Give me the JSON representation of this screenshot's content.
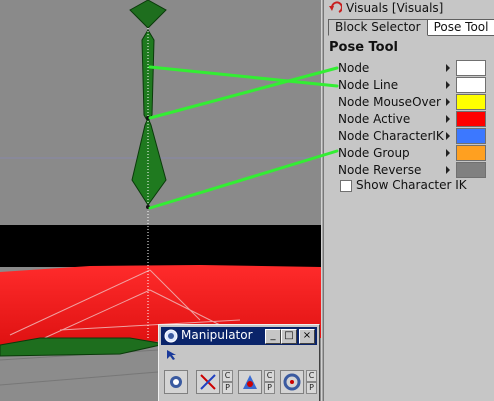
{
  "panel": {
    "title": "Visuals [Visuals]",
    "tabs": [
      {
        "label": "Block Selector"
      },
      {
        "label": "Pose Tool"
      }
    ],
    "section_title": "Pose Tool",
    "properties": [
      {
        "label": "Node",
        "color": "#ffffff"
      },
      {
        "label": "Node Line",
        "color": "#ffffff"
      },
      {
        "label": "Node MouseOver",
        "color": "#ffff00"
      },
      {
        "label": "Node Active",
        "color": "#ff0000"
      },
      {
        "label": "Node CharacterIK",
        "color": "#3c78ff"
      },
      {
        "label": "Node Group",
        "color": "#ffa020"
      },
      {
        "label": "Node Reverse",
        "color": "#808080"
      }
    ],
    "checkbox": {
      "label": "Show Character IK",
      "checked": false
    }
  },
  "manipulator": {
    "title": "Manipulator",
    "buttons": {
      "minimize": "_",
      "maximize": "□",
      "close": "×"
    },
    "cp_labels": [
      "C",
      "P"
    ]
  },
  "colors": {
    "viewport_bg": "#8a8a8a",
    "floor_red": "#ff1a1a",
    "band_black": "#000000",
    "bone_green": "#1e6e1e",
    "pointer_green": "#33ee33",
    "titlebar_blue": "#0a246a"
  }
}
